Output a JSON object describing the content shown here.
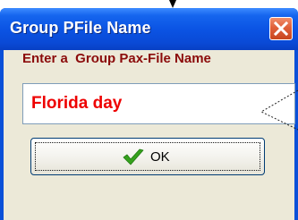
{
  "dialog": {
    "title": "Group PFile Name",
    "prompt": "Enter a  Group Pax-File Name",
    "name_value": "Florida day",
    "ok_label": "OK"
  },
  "icons": {
    "close": "close-x-icon",
    "ok": "green-checkmark-icon",
    "cursor": "mouse-pointer-icon"
  },
  "colors": {
    "titlebar": "#0b54e4",
    "client_background": "#ece9d8",
    "prompt_text": "#8b0b0b",
    "field_text": "#ee0000",
    "close_button": "#e0603a",
    "checkmark": "#36a11d"
  }
}
